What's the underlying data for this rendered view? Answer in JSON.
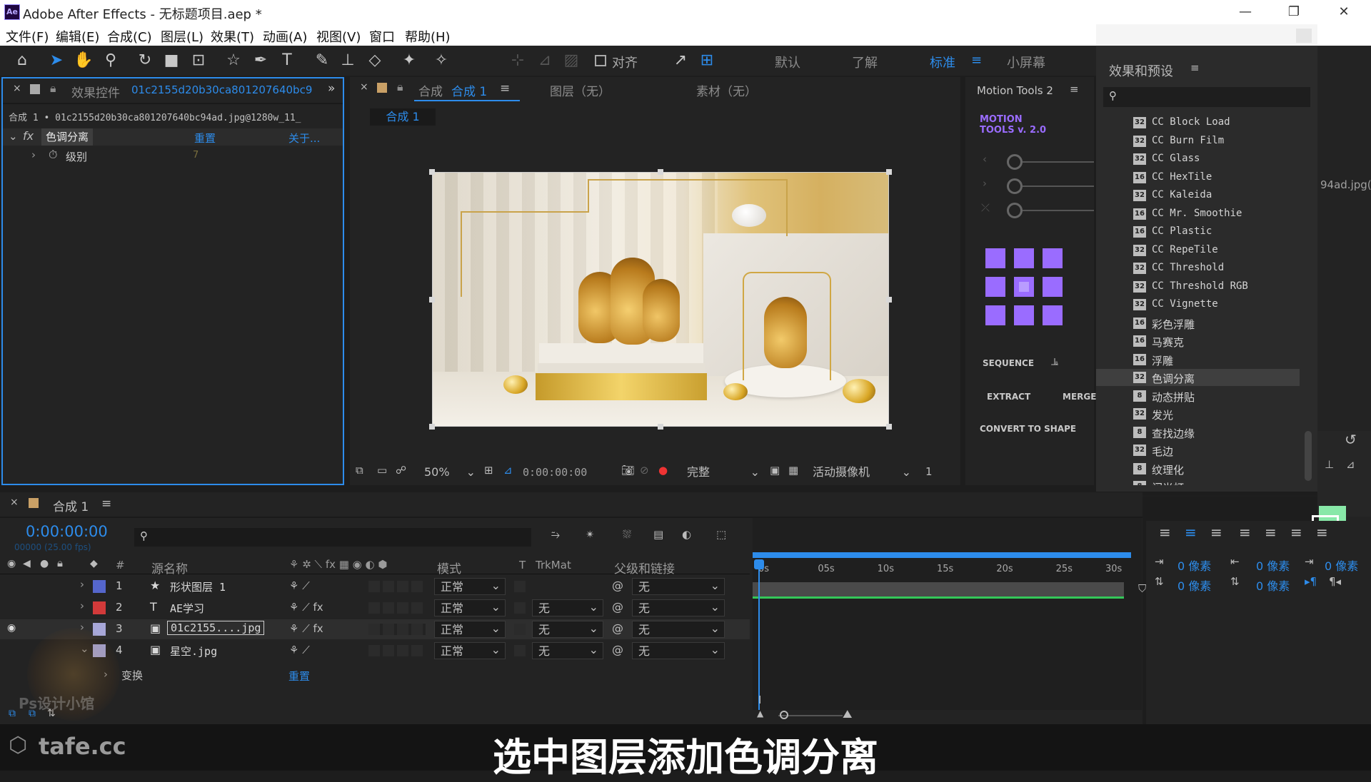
{
  "window": {
    "app_icon": "Ae",
    "title": "Adobe After Effects - 无标题项目.aep *",
    "minimize": "—",
    "restore": "❐",
    "close": "✕"
  },
  "menu": [
    "文件(F)",
    "编辑(E)",
    "合成(C)",
    "图层(L)",
    "效果(T)",
    "动画(A)",
    "视图(V)",
    "窗口",
    "帮助(H)"
  ],
  "toolbar": {
    "snap_label": "对齐",
    "workspaces": [
      "默认",
      "了解",
      "标准",
      "小屏幕"
    ],
    "active_workspace": "标准"
  },
  "effects_panel": {
    "tab_label": "效果控件",
    "tab_file": "01c2155d20b30ca801207640bc9",
    "subheader": "合成 1 • 01c2155d20b30ca801207640bc94ad.jpg@1280w_11_",
    "effect_name": "色调分离",
    "reset": "重置",
    "about": "关于...",
    "param_label": "级别",
    "param_value": "7"
  },
  "viewer": {
    "tab_prefix": "合成",
    "tab_name": "合成 1",
    "layer_tab": "图层（无）",
    "footage_tab": "素材（无）",
    "comp_chip": "合成 1",
    "zoom": "50%",
    "timecode": "0:00:00:00",
    "resolution": "完整",
    "camera": "活动摄像机",
    "views": "1"
  },
  "motion_tools": {
    "title": "Motion Tools 2",
    "logo_line1": "MOTION",
    "logo_line2": "TOOLS v. 2.0",
    "sequence": "SEQUENCE",
    "extract": "EXTRACT",
    "merge": "MERGE",
    "convert": "CONVERT TO SHAPE",
    "accent": "#9a6cff"
  },
  "effects_presets": {
    "title": "效果和预设",
    "items": [
      {
        "bits": "32",
        "name": "CC Block Load"
      },
      {
        "bits": "32",
        "name": "CC Burn Film"
      },
      {
        "bits": "32",
        "name": "CC Glass"
      },
      {
        "bits": "16",
        "name": "CC HexTile"
      },
      {
        "bits": "32",
        "name": "CC Kaleida"
      },
      {
        "bits": "16",
        "name": "CC Mr. Smoothie"
      },
      {
        "bits": "16",
        "name": "CC Plastic"
      },
      {
        "bits": "32",
        "name": "CC RepeTile"
      },
      {
        "bits": "32",
        "name": "CC Threshold"
      },
      {
        "bits": "32",
        "name": "CC Threshold RGB"
      },
      {
        "bits": "32",
        "name": "CC Vignette"
      },
      {
        "bits": "16",
        "name": "彩色浮雕"
      },
      {
        "bits": "16",
        "name": "马赛克"
      },
      {
        "bits": "16",
        "name": "浮雕"
      },
      {
        "bits": "32",
        "name": "色调分离"
      },
      {
        "bits": "8",
        "name": "动态拼贴"
      },
      {
        "bits": "32",
        "name": "发光"
      },
      {
        "bits": "8",
        "name": "查找边缘"
      },
      {
        "bits": "32",
        "name": "毛边"
      },
      {
        "bits": "8",
        "name": "纹理化"
      },
      {
        "bits": "8",
        "name": "闪光灯"
      }
    ],
    "selected_index": 14
  },
  "right_edge": {
    "filename_fragment": "94ad.jpg("
  },
  "timeline": {
    "tab_label": "合成 1",
    "timecode": "0:00:00:00",
    "frame_info": "00000 (25.00 fps)",
    "columns": {
      "num": "#",
      "source": "源名称",
      "mode": "模式",
      "t": "T",
      "trkmat": "TrkMat",
      "parent": "父级和链接"
    },
    "ruler": [
      "0s",
      "05s",
      "10s",
      "15s",
      "20s",
      "25s",
      "30s"
    ],
    "layers": [
      {
        "num": "1",
        "type": "★",
        "name": "形状图层 1",
        "color": "#5566cc",
        "mode": "正常",
        "trkmat": "",
        "parent": "无",
        "bar": "#4757a8",
        "fx": false,
        "visible": false
      },
      {
        "num": "2",
        "type": "T",
        "name": "AE学习",
        "color": "#d23a3a",
        "mode": "正常",
        "trkmat": "无",
        "parent": "无",
        "bar": "#a93a3a",
        "fx": true,
        "visible": false
      },
      {
        "num": "3",
        "type": "▣",
        "name": "01c2155....jpg",
        "color": "#a7a7d8",
        "mode": "正常",
        "trkmat": "无",
        "parent": "无",
        "bar": "#8d8db8",
        "fx": true,
        "visible": true
      },
      {
        "num": "4",
        "type": "▣",
        "name": "星空.jpg",
        "color": "#a7a7d8",
        "mode": "正常",
        "trkmat": "无",
        "parent": "无",
        "bar": "#7a7a8e",
        "fx": false,
        "visible": false
      }
    ],
    "transform_label": "变换",
    "transform_reset": "重置"
  },
  "paragraph": {
    "unit1": "0 像素",
    "unit2": "0 像素",
    "unit3": "0 像素",
    "unit4": "0 像素",
    "unit5": "0 像素"
  },
  "watermarks": {
    "site": "tafe.cc",
    "channel": "Ps设计小馆"
  },
  "subtitle": "选中图层添加色调分离",
  "colors": {
    "accent_blue": "#2d8ceb",
    "selection_highlight": "#3f3f3f",
    "swatch_green": "#88e8a8"
  }
}
